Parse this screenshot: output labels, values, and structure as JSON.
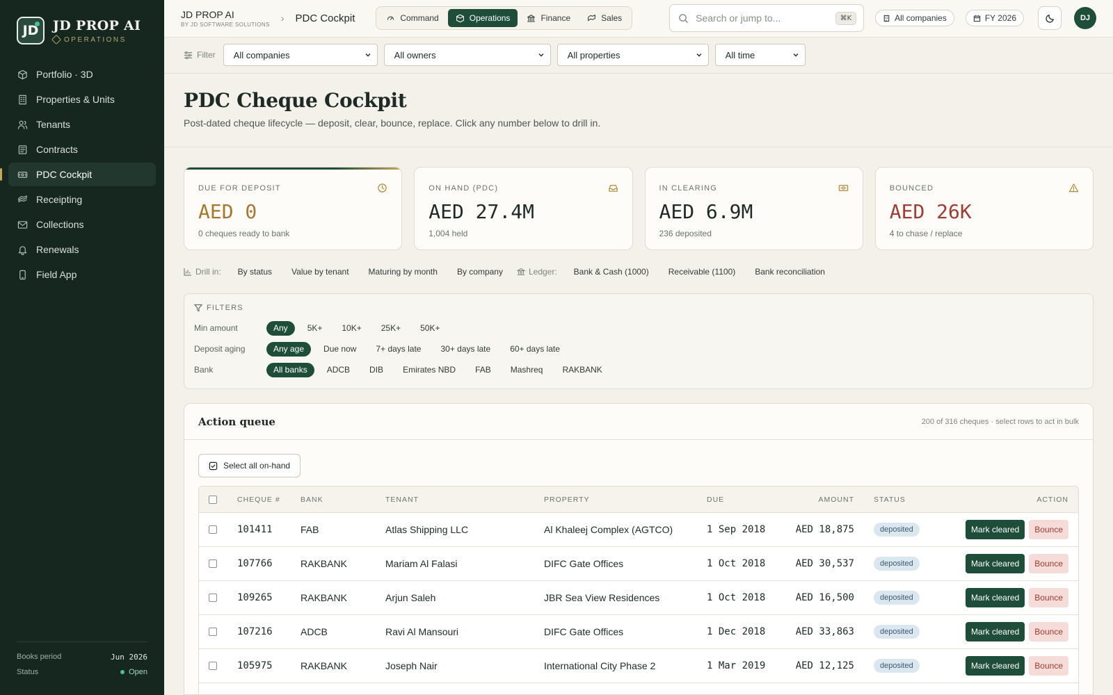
{
  "brand": {
    "logo": "JD",
    "name": "JD PROP AI",
    "sub": "OPERATIONS"
  },
  "nav": [
    {
      "label": "Portfolio · 3D",
      "icon": "cube-icon"
    },
    {
      "label": "Properties & Units",
      "icon": "building-icon"
    },
    {
      "label": "Tenants",
      "icon": "users-icon"
    },
    {
      "label": "Contracts",
      "icon": "contract-icon"
    },
    {
      "label": "PDC Cockpit",
      "icon": "cheque-icon",
      "active": true
    },
    {
      "label": "Receipting",
      "icon": "receipt-icon"
    },
    {
      "label": "Collections",
      "icon": "mail-icon"
    },
    {
      "label": "Renewals",
      "icon": "bell-icon"
    },
    {
      "label": "Field App",
      "icon": "phone-icon"
    }
  ],
  "sidebar_footer": {
    "period_label": "Books period",
    "period_value": "Jun  2026",
    "status_label": "Status",
    "status_value": "Open"
  },
  "topbar": {
    "app_name": "JD PROP AI",
    "app_by": "BY JD SOFTWARE SOLUTIONS",
    "page": "PDC Cockpit",
    "modes": [
      "Command",
      "Operations",
      "Finance",
      "Sales"
    ],
    "active_mode": "Operations",
    "search_placeholder": "Search or jump to...",
    "search_kbd": "⌘K",
    "company_pill": "All companies",
    "fy_pill": "FY 2026",
    "avatar": "DJ"
  },
  "filterbar": {
    "label": "Filter",
    "selects": [
      "All companies",
      "All owners",
      "All properties",
      "All time"
    ]
  },
  "header": {
    "title": "PDC Cheque Cockpit",
    "subtitle": "Post-dated cheque lifecycle — deposit, clear, bounce, replace. Click any number below to drill in."
  },
  "kpis": [
    {
      "label": "DUE FOR DEPOSIT",
      "value": "AED 0",
      "sub": "0 cheques ready to bank",
      "tone": "gold",
      "icon": "clock-icon"
    },
    {
      "label": "ON HAND (PDC)",
      "value": "AED 27.4M",
      "sub": "1,004 held",
      "tone": "",
      "icon": "inbox-icon"
    },
    {
      "label": "IN CLEARING",
      "value": "AED 6.9M",
      "sub": "236 deposited",
      "tone": "",
      "icon": "banknote-icon"
    },
    {
      "label": "BOUNCED",
      "value": "AED 26K",
      "sub": "4 to chase / replace",
      "tone": "red",
      "icon": "warning-icon"
    }
  ],
  "drill": {
    "label": "Drill in:",
    "links": [
      "By status",
      "Value by tenant",
      "Maturing by month",
      "By company"
    ],
    "ledger_label": "Ledger:",
    "ledger_links": [
      "Bank & Cash (1000)",
      "Receivable (1100)",
      "Bank reconciliation"
    ]
  },
  "filters": {
    "title": "FILTERS",
    "rows": [
      {
        "label": "Min amount",
        "chips": [
          "Any",
          "5K+",
          "10K+",
          "25K+",
          "50K+"
        ],
        "active": 0
      },
      {
        "label": "Deposit aging",
        "chips": [
          "Any age",
          "Due now",
          "7+ days late",
          "30+ days late",
          "60+ days late"
        ],
        "active": 0
      },
      {
        "label": "Bank",
        "chips": [
          "All banks",
          "ADCB",
          "DIB",
          "Emirates NBD",
          "FAB",
          "Mashreq",
          "RAKBANK"
        ],
        "active": 0
      }
    ]
  },
  "queue": {
    "title": "Action queue",
    "meta": "200 of 316 cheques · select rows to act in bulk",
    "select_all": "Select all on-hand",
    "columns": {
      "no": "CHEQUE #",
      "bank": "BANK",
      "tenant": "TENANT",
      "property": "PROPERTY",
      "due": "DUE",
      "amount": "AMOUNT",
      "status": "STATUS",
      "action": "ACTION"
    },
    "action_primary": "Mark cleared",
    "action_secondary": "Bounce",
    "rows": [
      {
        "no": "101411",
        "bank": "FAB",
        "tenant": "Atlas Shipping LLC",
        "property": "Al Khaleej Complex (AGTCO)",
        "due": "1 Sep 2018",
        "amount": "AED 18,875",
        "status": "deposited"
      },
      {
        "no": "107766",
        "bank": "RAKBANK",
        "tenant": "Mariam Al Falasi",
        "property": "DIFC Gate Offices",
        "due": "1 Oct 2018",
        "amount": "AED 30,537",
        "status": "deposited"
      },
      {
        "no": "109265",
        "bank": "RAKBANK",
        "tenant": "Arjun Saleh",
        "property": "JBR Sea View Residences",
        "due": "1 Oct 2018",
        "amount": "AED 16,500",
        "status": "deposited"
      },
      {
        "no": "107216",
        "bank": "ADCB",
        "tenant": "Ravi Al Mansouri",
        "property": "DIFC Gate Offices",
        "due": "1 Dec 2018",
        "amount": "AED 33,863",
        "status": "deposited"
      },
      {
        "no": "105975",
        "bank": "RAKBANK",
        "tenant": "Joseph Nair",
        "property": "International City Phase 2",
        "due": "1 Mar 2019",
        "amount": "AED 12,125",
        "status": "deposited"
      },
      {
        "no": "",
        "bank": "",
        "tenant": "",
        "property": "",
        "due": "",
        "amount": "",
        "status": ""
      }
    ]
  }
}
